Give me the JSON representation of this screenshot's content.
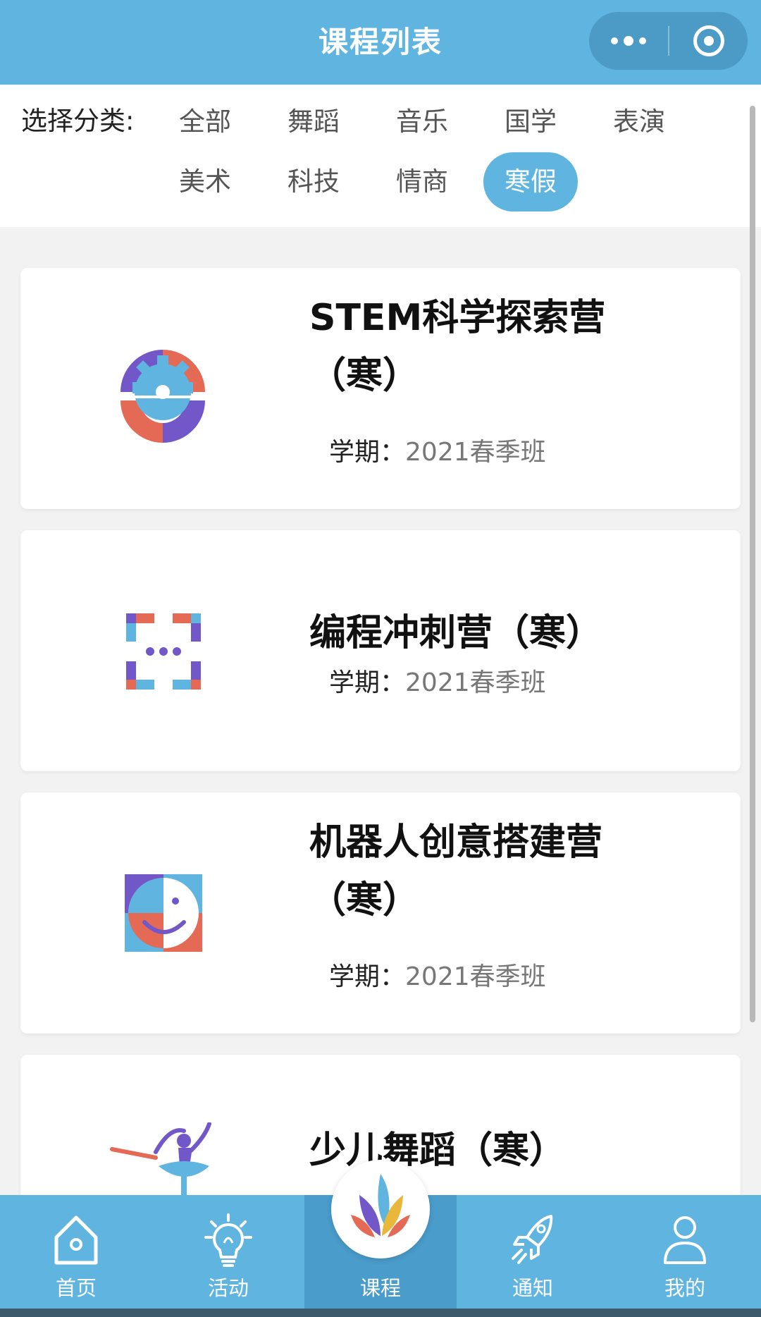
{
  "header": {
    "title": "课程列表",
    "more_icon": "more-dots-icon",
    "close_icon": "target-circle-icon",
    "background": "#5fb4e0"
  },
  "filter": {
    "label": "选择分类:",
    "categories": [
      "全部",
      "舞蹈",
      "音乐",
      "国学",
      "表演",
      "美术",
      "科技",
      "情商",
      "寒假"
    ],
    "active": "寒假",
    "active_color": "#5fb4e0"
  },
  "courses": [
    {
      "title": "STEM科学探索营（寒）",
      "term_label": "学期：",
      "term_value": "2021春季班",
      "icon": "gear-split-icon"
    },
    {
      "title": "编程冲刺营（寒）",
      "term_label": "学期：",
      "term_value": "2021春季班",
      "icon": "code-brackets-icon"
    },
    {
      "title": "机器人创意搭建营（寒）",
      "term_label": "学期：",
      "term_value": "2021春季班",
      "icon": "robot-face-icon"
    },
    {
      "title": "少儿舞蹈（寒）",
      "icon": "ballet-dancer-icon"
    }
  ],
  "tabbar": {
    "tabs": [
      {
        "label": "首页",
        "icon": "home-icon"
      },
      {
        "label": "活动",
        "icon": "lightbulb-icon"
      },
      {
        "label": "课程",
        "icon": "flame-logo-icon"
      },
      {
        "label": "通知",
        "icon": "rocket-icon"
      },
      {
        "label": "我的",
        "icon": "user-icon"
      }
    ],
    "active": "课程",
    "background": "#5fb4e0"
  }
}
